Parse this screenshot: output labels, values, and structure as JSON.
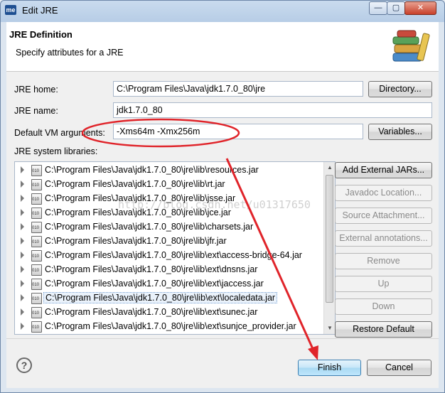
{
  "window": {
    "title": "Edit JRE",
    "app_icon": "me",
    "controls": {
      "minimize": "—",
      "maximize": "▢",
      "close": "✕"
    }
  },
  "header": {
    "title": "JRE Definition",
    "subtitle": "Specify attributes for a JRE",
    "icon": "books-icon"
  },
  "form": {
    "jre_home": {
      "label": "JRE home:",
      "value": "C:\\Program Files\\Java\\jdk1.7.0_80\\jre",
      "button": "Directory..."
    },
    "jre_name": {
      "label": "JRE name:",
      "value": "jdk1.7.0_80"
    },
    "vm_args": {
      "label": "Default VM arguments:",
      "value": "-Xms64m   -Xmx256m",
      "button": "Variables..."
    },
    "libraries_label": "JRE system libraries:"
  },
  "libraries": [
    "C:\\Program Files\\Java\\jdk1.7.0_80\\jre\\lib\\resources.jar",
    "C:\\Program Files\\Java\\jdk1.7.0_80\\jre\\lib\\rt.jar",
    "C:\\Program Files\\Java\\jdk1.7.0_80\\jre\\lib\\jsse.jar",
    "C:\\Program Files\\Java\\jdk1.7.0_80\\jre\\lib\\jce.jar",
    "C:\\Program Files\\Java\\jdk1.7.0_80\\jre\\lib\\charsets.jar",
    "C:\\Program Files\\Java\\jdk1.7.0_80\\jre\\lib\\jfr.jar",
    "C:\\Program Files\\Java\\jdk1.7.0_80\\jre\\lib\\ext\\access-bridge-64.jar",
    "C:\\Program Files\\Java\\jdk1.7.0_80\\jre\\lib\\ext\\dnsns.jar",
    "C:\\Program Files\\Java\\jdk1.7.0_80\\jre\\lib\\ext\\jaccess.jar",
    "C:\\Program Files\\Java\\jdk1.7.0_80\\jre\\lib\\ext\\localedata.jar",
    "C:\\Program Files\\Java\\jdk1.7.0_80\\jre\\lib\\ext\\sunec.jar",
    "C:\\Program Files\\Java\\jdk1.7.0_80\\jre\\lib\\ext\\sunjce_provider.jar"
  ],
  "selected_library_index": 9,
  "side_buttons": {
    "add_external": "Add External JARs...",
    "javadoc": "Javadoc Location...",
    "source": "Source Attachment...",
    "external_annotations": "External annotations...",
    "remove": "Remove",
    "up": "Up",
    "down": "Down",
    "restore": "Restore Default"
  },
  "footer": {
    "help": "?",
    "finish": "Finish",
    "cancel": "Cancel"
  },
  "watermark": "http://blog.csdn.net/u01317650",
  "colors": {
    "annotation_red": "#e0242a",
    "title_bar": "#b7cde6",
    "default_button": "#bee6fd"
  }
}
